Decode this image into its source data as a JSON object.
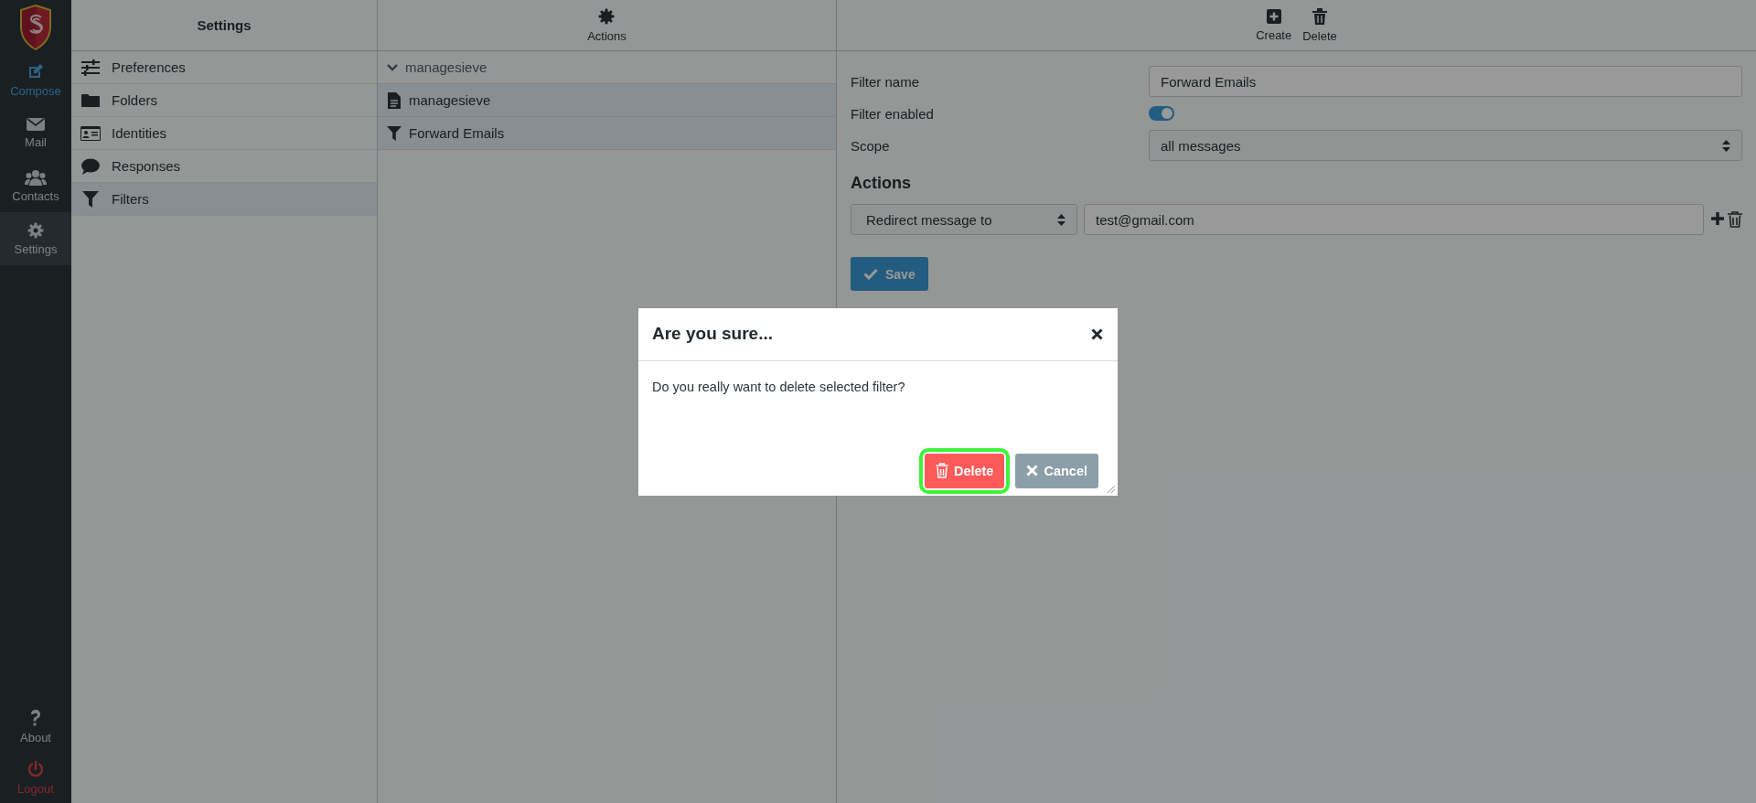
{
  "rail": {
    "items": [
      {
        "label": "Compose",
        "kind": "accent",
        "selected": false
      },
      {
        "label": "Mail",
        "kind": "normal",
        "selected": false
      },
      {
        "label": "Contacts",
        "kind": "normal",
        "selected": false
      },
      {
        "label": "Settings",
        "kind": "normal",
        "selected": true
      }
    ],
    "bottom_items": [
      {
        "label": "About",
        "kind": "normal"
      },
      {
        "label": "Logout",
        "kind": "danger"
      }
    ]
  },
  "settings_panel": {
    "title": "Settings",
    "items": [
      {
        "label": "Preferences",
        "selected": false
      },
      {
        "label": "Folders",
        "selected": false
      },
      {
        "label": "Identities",
        "selected": false
      },
      {
        "label": "Responses",
        "selected": false
      },
      {
        "label": "Filters",
        "selected": true
      }
    ]
  },
  "actions_panel": {
    "header": "Actions",
    "tree": {
      "label": "managesieve",
      "expanded": true,
      "children": [
        {
          "label": "managesieve",
          "kind": "script",
          "selected": true
        },
        {
          "label": "Forward Emails",
          "kind": "filter",
          "selected": true
        }
      ]
    }
  },
  "filter_form": {
    "toolbar": [
      {
        "label": "Create",
        "kind": "create"
      },
      {
        "label": "Delete",
        "kind": "delete"
      }
    ],
    "filter_name": {
      "label": "Filter name",
      "value": "Forward Emails"
    },
    "filter_enabled": {
      "label": "Filter enabled",
      "on": true
    },
    "scope": {
      "label": "Scope",
      "value": "all messages"
    },
    "actions_heading": "Actions",
    "actions": [
      {
        "type": "Redirect message to",
        "value": "test@gmail.com"
      }
    ],
    "save_button": "Save"
  },
  "dialog": {
    "title": "Are you sure...",
    "message": "Do you really want to delete selected filter?",
    "buttons": [
      {
        "label": "Delete",
        "kind": "danger"
      },
      {
        "label": "Cancel",
        "kind": "secondary"
      }
    ]
  }
}
